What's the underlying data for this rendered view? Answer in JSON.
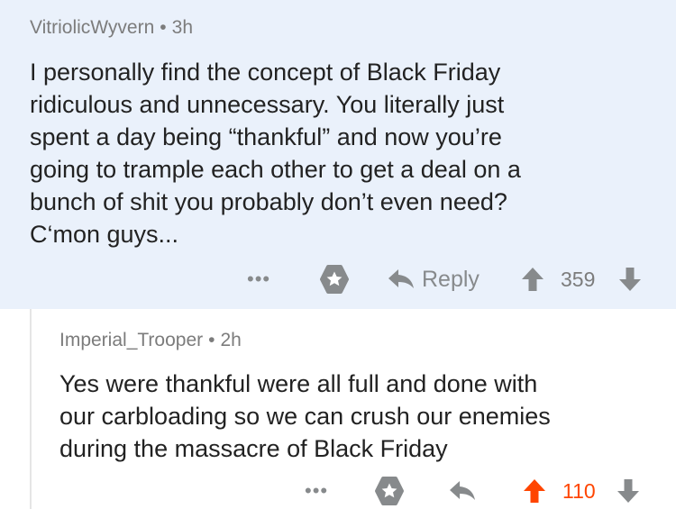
{
  "comments": [
    {
      "author": "VitriolicWyvern",
      "separator": "•",
      "age": "3h",
      "lines": [
        "I personally find the concept of Black Friday",
        "ridiculous and unnecessary. You literally just",
        "spent a day being “thankful” and now you’re",
        "going to trample each other to get a deal on a",
        "bunch of shit you probably don’t even need?",
        "C‘mon guys..."
      ],
      "more_label": "•••",
      "reply_label": "Reply",
      "score": "359",
      "upvoted": false
    },
    {
      "author": "Imperial_Trooper",
      "separator": "•",
      "age": "2h",
      "lines": [
        "Yes were thankful were all full and done with",
        "our carbloading so we can crush our enemies",
        "during the massacre of Black Friday"
      ],
      "more_label": "•••",
      "score": "110",
      "upvoted": true
    }
  ],
  "icons": {
    "save": "star-badge-icon",
    "reply": "reply-arrow-icon",
    "upvote": "upvote-arrow-icon",
    "downvote": "downvote-arrow-icon",
    "more": "more-dots-icon"
  },
  "colors": {
    "highlight_background": "#eaf1fb",
    "upvote_orange": "#ff4500",
    "icon_gray": "#878a8c",
    "meta_gray": "#7c7c7c",
    "text": "#222222"
  }
}
